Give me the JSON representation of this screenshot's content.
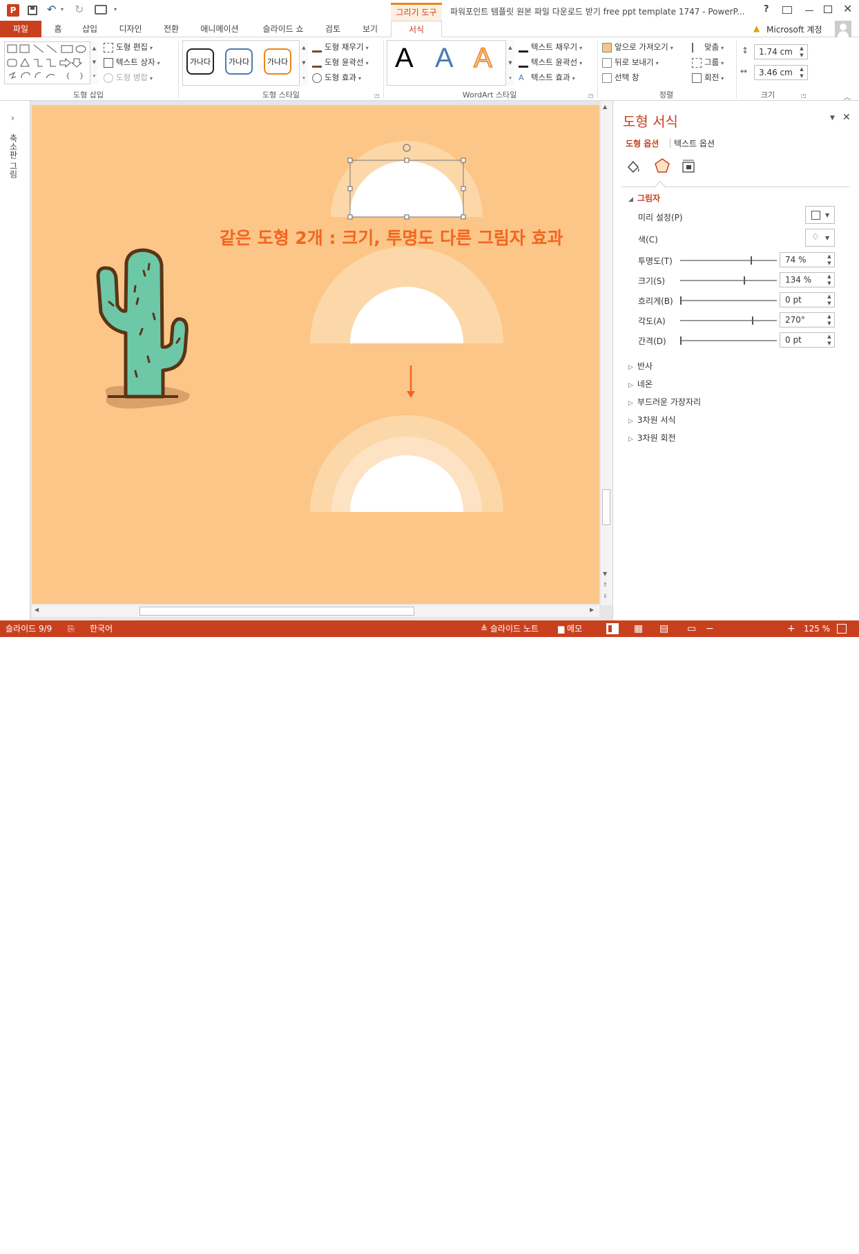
{
  "app": {
    "logo_text": "P",
    "context_tool_tab": "그리기 도구",
    "window_title": "파워포인트 템플릿 원본 파일 다운로드 받기 free ppt template 1747 - PowerP...",
    "help_icon_label": "?",
    "account": "Microsoft 계정",
    "colors": {
      "accent": "#c9401f",
      "slide_bg": "#fcc688",
      "title_text": "#f26522"
    }
  },
  "tabs": [
    "파일",
    "홈",
    "삽입",
    "디자인",
    "전환",
    "애니메이션",
    "슬라이드 쇼",
    "검토",
    "보기",
    "서식"
  ],
  "active_tab": "서식",
  "ribbon": {
    "insert_shapes": {
      "label": "도형 삽입",
      "edit_shape": "도형 편집",
      "text_box": "텍스트 상자",
      "merge_shapes": "도형 병합"
    },
    "shape_styles": {
      "label": "도형 스타일",
      "samples": [
        "가나다",
        "가나다",
        "가나다"
      ],
      "fill": "도형 채우기",
      "outline": "도형 윤곽선",
      "effects": "도형 효과"
    },
    "wordart": {
      "label": "WordArt 스타일",
      "samples": [
        "A",
        "A",
        "A"
      ],
      "text_fill": "텍스트 채우기",
      "text_outline": "텍스트 윤곽선",
      "text_effects": "텍스트 효과"
    },
    "arrange": {
      "label": "정렬",
      "bring_forward": "앞으로 가져오기",
      "send_backward": "뒤로 보내기",
      "selection_pane": "선택 창",
      "align": "맞춤",
      "group": "그룹",
      "rotate": "회전"
    },
    "size": {
      "label": "크기",
      "height": "1.74 cm",
      "width": "3.46 cm"
    }
  },
  "left_panel": {
    "label": "축소판 그림"
  },
  "slide": {
    "title": "같은 도형 2개 : 크기, 투명도 다른 그림자 효과"
  },
  "format_pane": {
    "title": "도형 서식",
    "tabs": [
      "도형 옵션",
      "텍스트 옵션"
    ],
    "section_shadow": "그림자",
    "preset_label": "미리 설정(P)",
    "color_label": "색(C)",
    "rows": [
      {
        "label": "투명도(T)",
        "value": "74 %",
        "fraction": 0.74
      },
      {
        "label": "크기(S)",
        "value": "134 %",
        "fraction": 0.67
      },
      {
        "label": "흐리게(B)",
        "value": "0 pt",
        "fraction": 0.0
      },
      {
        "label": "각도(A)",
        "value": "270°",
        "fraction": 0.75
      },
      {
        "label": "간격(D)",
        "value": "0 pt",
        "fraction": 0.0
      }
    ],
    "collapsed_sections": [
      "반사",
      "네온",
      "부드러운 가장자리",
      "3차원 서식",
      "3차원 회전"
    ]
  },
  "status": {
    "slide_counter": "슬라이드 9/9",
    "language": "한국어",
    "notes": "슬라이드 노트",
    "comments": "메모",
    "zoom": "125 %"
  }
}
